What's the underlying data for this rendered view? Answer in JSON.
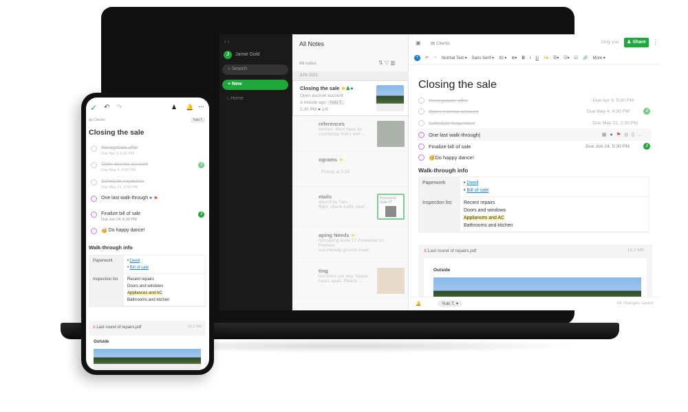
{
  "sidebar": {
    "user": "Jamie Gold",
    "user_initial": "J",
    "search_placeholder": "Search",
    "new_label": "New",
    "home_label": "Home"
  },
  "notelist": {
    "title": "All Notes",
    "count": "86 notes",
    "month": "JUN 2021",
    "items": [
      {
        "title": "Closing the sale",
        "snippet": "Open escrow account",
        "meta": "A minute ago",
        "tag": "Yuki T.",
        "due": "5:30 PM",
        "progress": "1/6"
      },
      {
        "title": "references",
        "snippet": "kitchen. Must have an",
        "snippet2": "countertop that's well ..."
      },
      {
        "title": "ograms",
        "snippet": "- Pickup at 5:30"
      },
      {
        "title": "etails",
        "snippet": "airport by 7am.",
        "snippet2": "flight, check traffic near ...",
        "ticket": "Proceed to Gate 07"
      },
      {
        "title": "aping Needs",
        "snippet": "ndscaping to-do 17 Pinewood Ln. Replace",
        "snippet2": "eco-friendly ground cover."
      },
      {
        "title": "ting",
        "snippet": "two twice per day. Space",
        "snippet2": "hours apart. Please ..."
      }
    ]
  },
  "editor": {
    "breadcrumb": "Clients",
    "visibility": "Only you",
    "share_label": "Share",
    "toolbar": {
      "style": "Normal Text",
      "font": "Sans Serif",
      "size": "30",
      "more": "More"
    },
    "title": "Closing the sale",
    "tasks": [
      {
        "label": "Renegotiate offer",
        "due": "Due Apr 3, 5:30 PM",
        "done": true
      },
      {
        "label": "Open escrow account",
        "due": "Due May 4, 4:30 PM",
        "done": true
      },
      {
        "label": "Schedule inspection",
        "due": "Due May 21, 2:30 PM",
        "done": true
      },
      {
        "label": "One last walk-through",
        "due": "",
        "done": false
      },
      {
        "label": "Finalize bill of sale",
        "due": "Due Jun 24, 5:30 PM",
        "done": false
      },
      {
        "label": "Do happy dance!",
        "due": "",
        "done": false
      }
    ],
    "section": "Walk-through info",
    "table": {
      "row1_header": "Paperwork",
      "row1_items": [
        "Deed",
        "Bill of sale"
      ],
      "row2_header": "Inspection list",
      "row2_items": [
        "Recent repairs",
        "Doors and windows",
        "Appliances and AC",
        "Bathrooms and kitchen"
      ]
    },
    "attachment": {
      "name": "Last round of repairs.pdf",
      "size": "13.2 MB",
      "page_heading": "Outside"
    },
    "footer": {
      "assignee": "Yuki T.",
      "status": "All changes saved"
    }
  },
  "phone": {
    "breadcrumb": "Clients",
    "tag": "Yuki T.",
    "title": "Closing the sale",
    "tasks": [
      {
        "label": "Renegotiate offer",
        "due": "Due Apr 3, 5:30 PM"
      },
      {
        "label": "Open escrow account",
        "due": "Due May 4, 4:30 PM"
      },
      {
        "label": "Schedule inspection",
        "due": "Due May 21, 2:30 PM"
      },
      {
        "label": "One last walk-through",
        "due": ""
      },
      {
        "label": "Finalize bill of sale",
        "due": "Due Jun 24, 5:30 PM"
      },
      {
        "label": "Do happy dance!",
        "due": ""
      }
    ]
  },
  "colors": {
    "accent": "#1ea83c",
    "link": "#1a7fd4",
    "highlight": "#fff3b0",
    "checkbox": "#c278d0"
  }
}
